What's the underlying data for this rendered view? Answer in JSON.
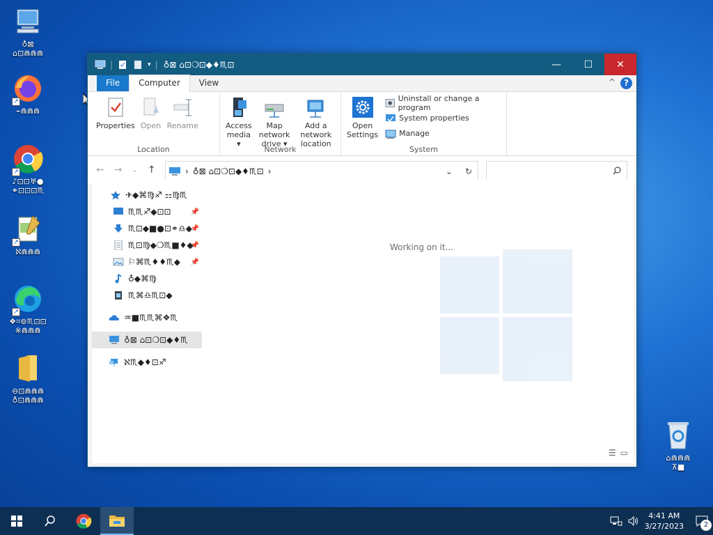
{
  "desktop": {
    "icons": [
      {
        "label": "♁⊠\n⌂⊡⋒⋒⋒",
        "kind": "computer"
      },
      {
        "label": "⌁⋒⋒⋒",
        "kind": "firefox"
      },
      {
        "label": "♪⊡⊡♅●\n⚭⊡⊡⊡♏",
        "kind": "chrome"
      },
      {
        "label": "ℵ⋒⋒⋒",
        "kind": "notepad"
      },
      {
        "label": "❖⌗⊚♏⊡⊡\n※⋒⋒⋒",
        "kind": "edge"
      },
      {
        "label": "⊖⊡⋒⋒⋒\n♁⊡⋒⋒⋒",
        "kind": "folder"
      },
      {
        "label": "⌂⋒⋒⋒\n⊼■",
        "kind": "recycle-bin"
      }
    ]
  },
  "window": {
    "title": "♁⊠ ⌂⊡❍⊡◆♦♏⊡",
    "controls": {
      "minimize": "—",
      "maximize": "☐",
      "close": "✕"
    },
    "tabs": [
      "File",
      "Computer",
      "View"
    ],
    "help": "?",
    "collapse": "^",
    "ribbon": {
      "location": {
        "name": "Location",
        "buttons": [
          "Properties",
          "Open",
          "Rename"
        ]
      },
      "network": {
        "name": "Network",
        "buttons": [
          "Access\nmedia ▾",
          "Map network\ndrive ▾",
          "Add a network\nlocation"
        ]
      },
      "system": {
        "name": "System",
        "open_settings": "Open\nSettings",
        "items": [
          "Uninstall or change a program",
          "System properties",
          "Manage"
        ]
      }
    },
    "address": {
      "path": "♁⊠   ⌂⊡❍⊡◆♦♏⊡",
      "sep": "›",
      "dropdown": "⌄",
      "refresh": "↻"
    },
    "search": {
      "placeholder": ""
    },
    "nav": {
      "back": "←",
      "forward": "→",
      "recent": "⌄",
      "up": "↑"
    },
    "navpane": [
      {
        "label": "✈◆⌘♍♐ ⚏♍♏",
        "icon": "star",
        "pin": false
      },
      {
        "label": "♏♏♐◆⊡⊡",
        "icon": "desktop",
        "pin": true
      },
      {
        "label": "♏⊡◆■●⊡⚭♎◆",
        "icon": "download",
        "pin": true
      },
      {
        "label": "♏⊡♍◆❍♏■♦◆",
        "icon": "documents",
        "pin": true
      },
      {
        "label": "⚐⌘♏♦♦♏◆",
        "icon": "pictures",
        "pin": true
      },
      {
        "label": "♁◆⌘♍",
        "icon": "music",
        "pin": false
      },
      {
        "label": "♏⌘♎♏⊡◆",
        "icon": "videos",
        "pin": false
      },
      {
        "label": "♒■♏♏⌘❖♏",
        "icon": "onedrive",
        "pin": false
      },
      {
        "label": "♁⊠ ⌂⊡❍⊡◆♦♏",
        "icon": "this-pc",
        "pin": false,
        "selected": true
      },
      {
        "label": "ℵ♏◆♦⊡♐",
        "icon": "network",
        "pin": false
      }
    ],
    "status": "Working on it...",
    "view_icons": [
      "☰",
      "▭"
    ]
  },
  "taskbar": {
    "time": "4:41 AM",
    "date": "3/27/2023",
    "notification_count": "2"
  },
  "colors": {
    "titlebar": "#125c82",
    "close": "#c8282d",
    "file_tab": "#1979ca",
    "taskbar": "#0d2f52"
  }
}
